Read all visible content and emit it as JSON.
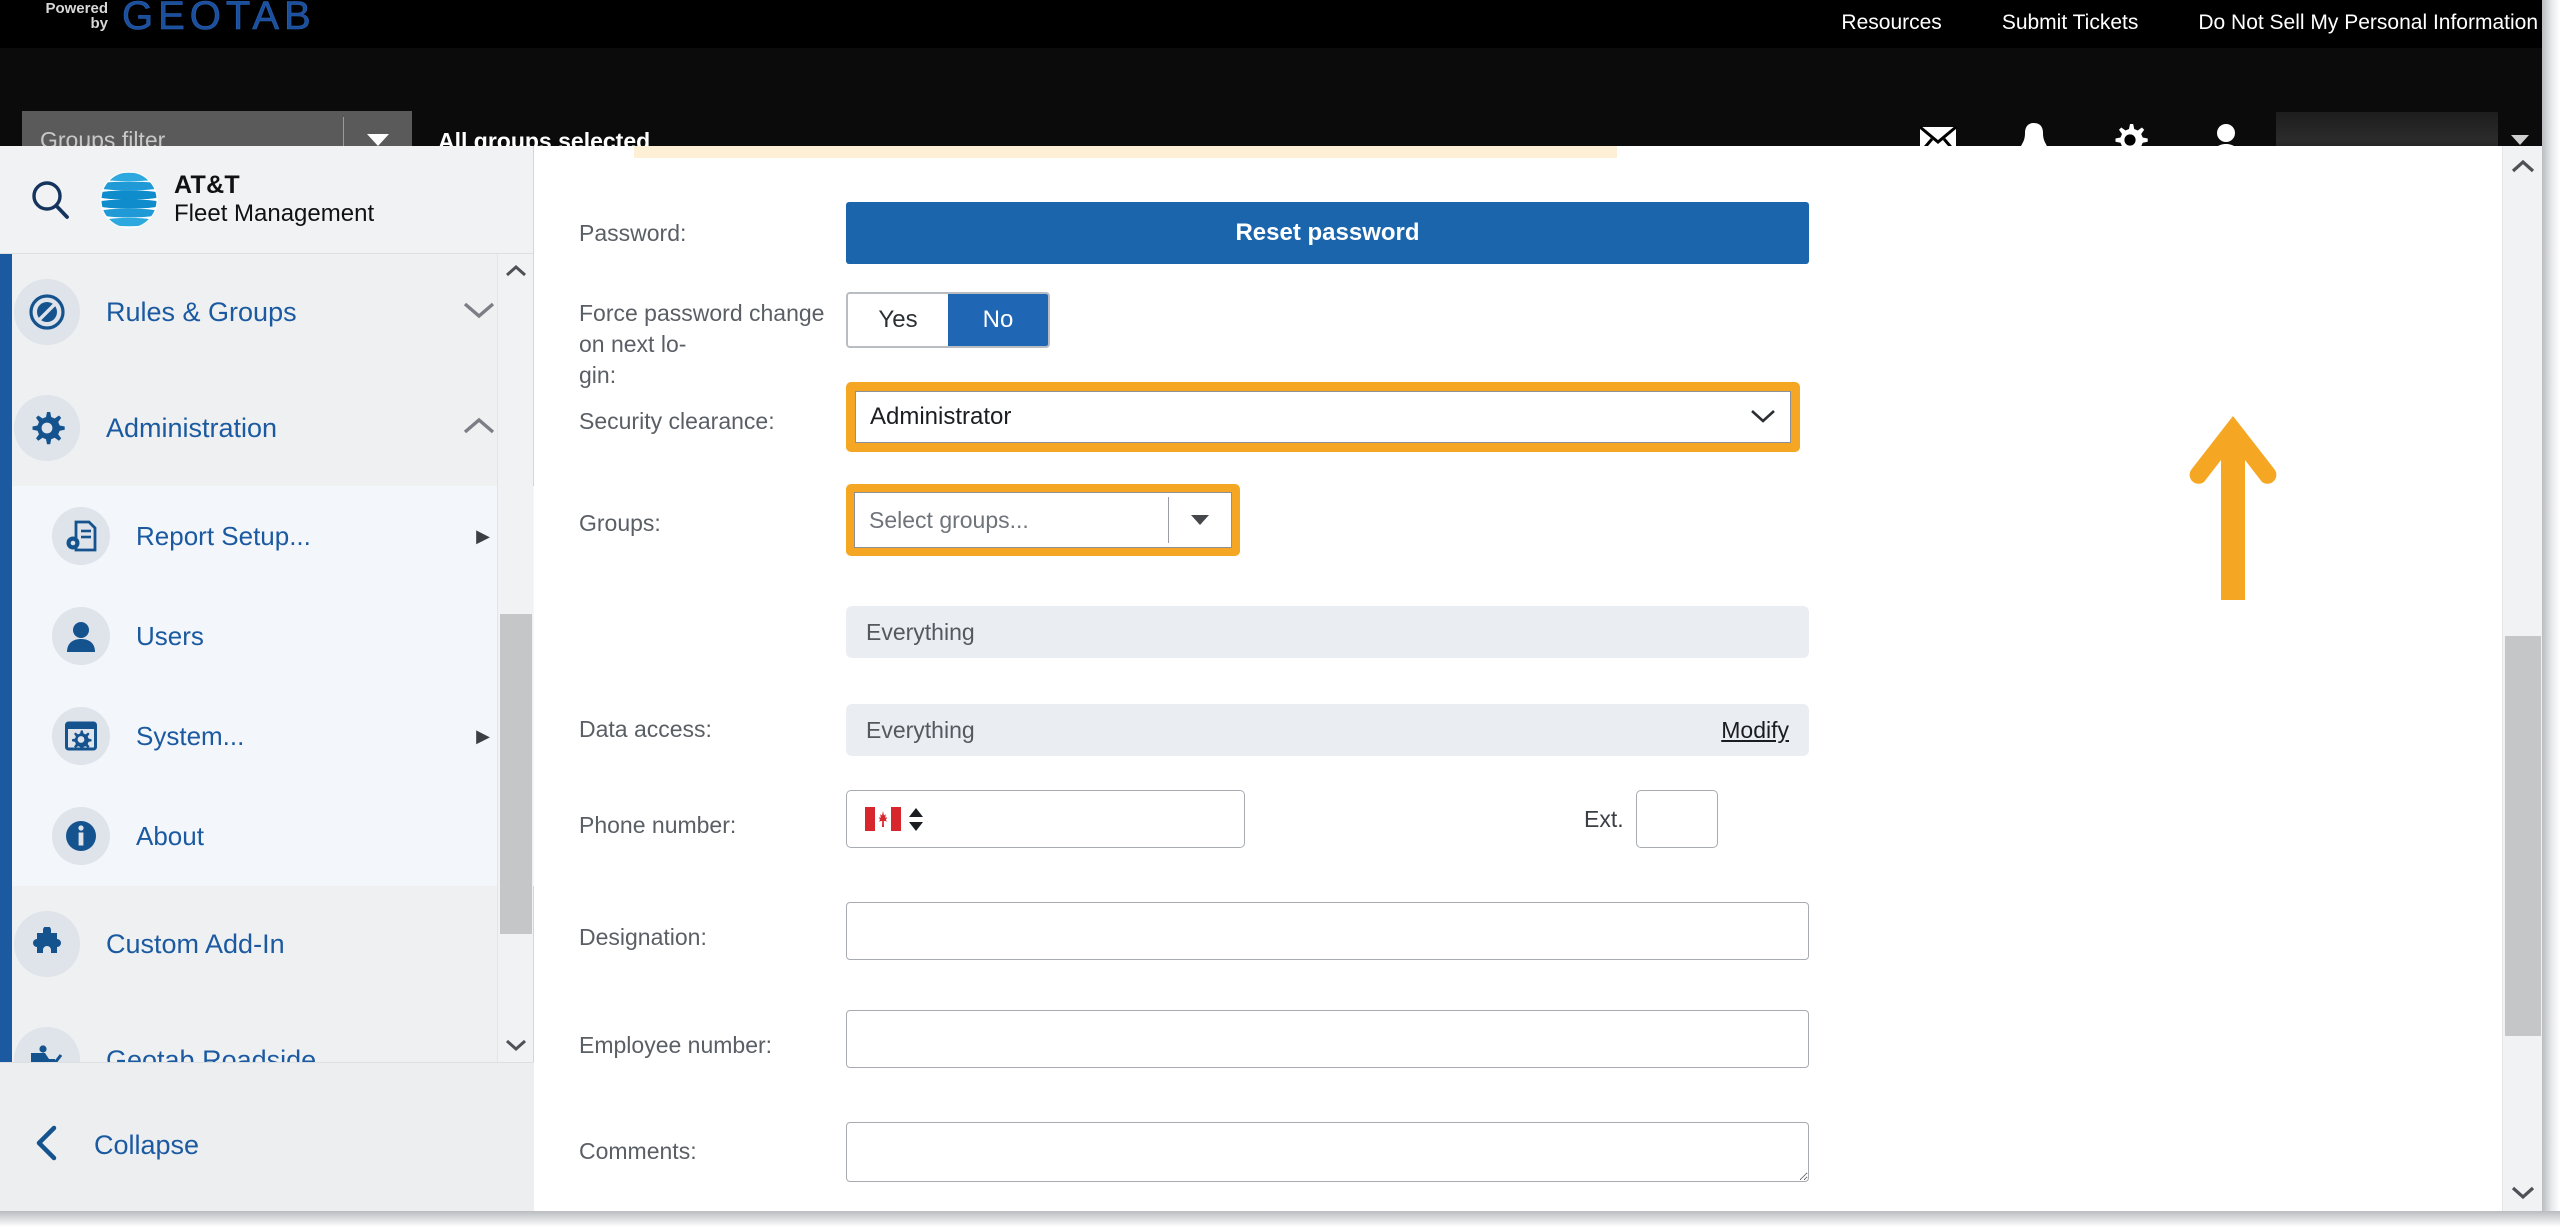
{
  "topbar": {
    "powered_line1": "Powered",
    "powered_line2": "by",
    "brand": "GEOTAB",
    "nav": [
      {
        "label": "Resources"
      },
      {
        "label": "Submit Tickets"
      },
      {
        "label": "Do Not Sell My Personal Information"
      }
    ],
    "icons": [
      {
        "name": "mail-icon"
      },
      {
        "name": "bell-icon"
      },
      {
        "name": "gear-icon"
      },
      {
        "name": "user-icon"
      }
    ]
  },
  "subbar": {
    "groups_filter_placeholder": "Groups filter",
    "groups_selected_text": "All groups selected"
  },
  "sidebar": {
    "logo": {
      "line1": "AT&T",
      "line2": "Fleet Management"
    },
    "search_icon": "search-icon",
    "items": [
      {
        "label": "Rules & Groups",
        "icon": "rules-icon",
        "expander": "chevron-down"
      },
      {
        "label": "Administration",
        "icon": "gear-icon",
        "expander": "chevron-up"
      }
    ],
    "sub_items": [
      {
        "label": "Report Setup...",
        "icon": "report-setup-icon",
        "has_arrow": true
      },
      {
        "label": "Users",
        "icon": "user-icon",
        "has_arrow": false
      },
      {
        "label": "System...",
        "icon": "system-icon",
        "has_arrow": true
      },
      {
        "label": "About",
        "icon": "info-icon",
        "has_arrow": false
      }
    ],
    "bottom_items": [
      {
        "label": "Custom Add-In",
        "icon": "puzzle-icon"
      },
      {
        "label": "Geotab Roadside",
        "icon": "tow-truck-icon"
      }
    ],
    "collapse": {
      "label": "Collapse",
      "icon": "chevron-left-icon"
    }
  },
  "form": {
    "password": {
      "label": "Password:",
      "reset_button": "Reset password"
    },
    "force_change": {
      "label": "Force password change on next lo-\ngin:",
      "label_line1": "Force password change on next lo-",
      "label_line2": "gin:",
      "options": [
        "Yes",
        "No"
      ],
      "selected": "No"
    },
    "security_clearance": {
      "label": "Security clearance:",
      "value": "Administrator",
      "highlighted": true
    },
    "groups": {
      "label": "Groups:",
      "placeholder": "Select groups...",
      "highlighted": true,
      "selected_pill": "Everything"
    },
    "data_access": {
      "label": "Data access:",
      "value": "Everything",
      "modify_link": "Modify"
    },
    "phone": {
      "label": "Phone number:",
      "country_flag": "canada-flag-icon",
      "value": "",
      "ext_label": "Ext.",
      "ext_value": ""
    },
    "designation": {
      "label": "Designation:",
      "value": ""
    },
    "employee_number": {
      "label": "Employee number:",
      "value": ""
    },
    "comments": {
      "label": "Comments:",
      "value": ""
    }
  },
  "annotation": {
    "arrow": "up-arrow-annotation",
    "color": "#f5a623"
  },
  "colors": {
    "accent_blue": "#1b65ac",
    "highlight_orange": "#f5a623",
    "sidebar_bg": "#eef0f2",
    "topbar_bg": "#000000"
  }
}
